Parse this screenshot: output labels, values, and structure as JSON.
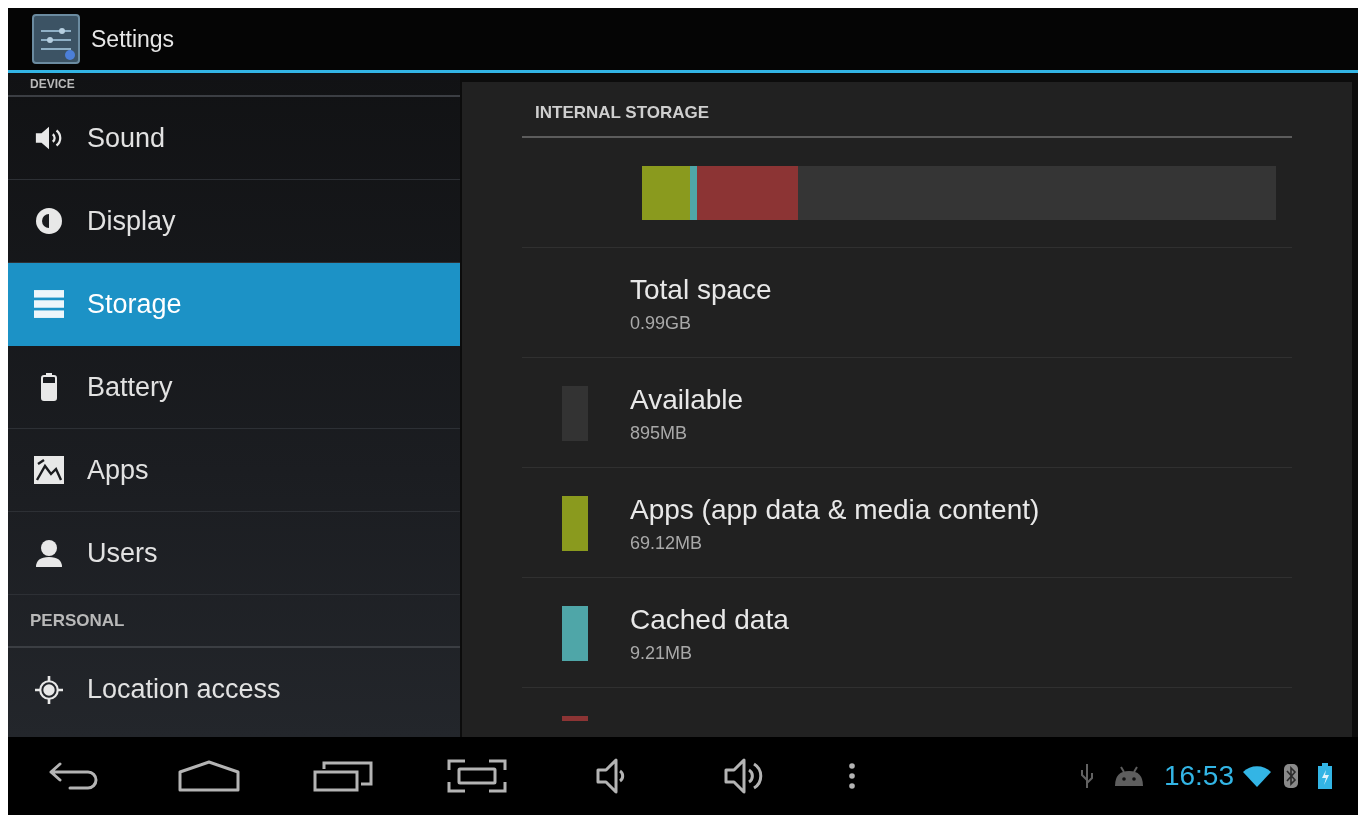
{
  "window": {
    "title": "Settings"
  },
  "sidebar": {
    "sections": [
      {
        "header": "DEVICE",
        "items": [
          {
            "label": "Sound",
            "selected": false
          },
          {
            "label": "Display",
            "selected": false
          },
          {
            "label": "Storage",
            "selected": true
          },
          {
            "label": "Battery",
            "selected": false
          },
          {
            "label": "Apps",
            "selected": false
          },
          {
            "label": "Users",
            "selected": false
          }
        ]
      },
      {
        "header": "PERSONAL",
        "items": [
          {
            "label": "Location access",
            "selected": false
          }
        ]
      }
    ]
  },
  "storage": {
    "header": "INTERNAL STORAGE",
    "bar": {
      "segments": [
        {
          "color": "#8a9a1e",
          "level": 0.075
        },
        {
          "color": "#4fa6a8",
          "level": 0.011
        },
        {
          "color": "#8c3434",
          "level": 0.16
        }
      ]
    },
    "rows": [
      {
        "kind": "total",
        "title": "Total space",
        "value": "0.99GB"
      },
      {
        "kind": "category",
        "title": "Available",
        "value": "895MB",
        "color": "#333333"
      },
      {
        "kind": "category",
        "title": "Apps (app data & media content)",
        "value": "69.12MB",
        "color": "#8a9a1e"
      },
      {
        "kind": "category",
        "title": "Cached data",
        "value": "9.21MB",
        "color": "#4fa6a8"
      },
      {
        "kind": "partial",
        "color": "#8c3434"
      }
    ]
  },
  "status_bar": {
    "time": "16:53"
  }
}
